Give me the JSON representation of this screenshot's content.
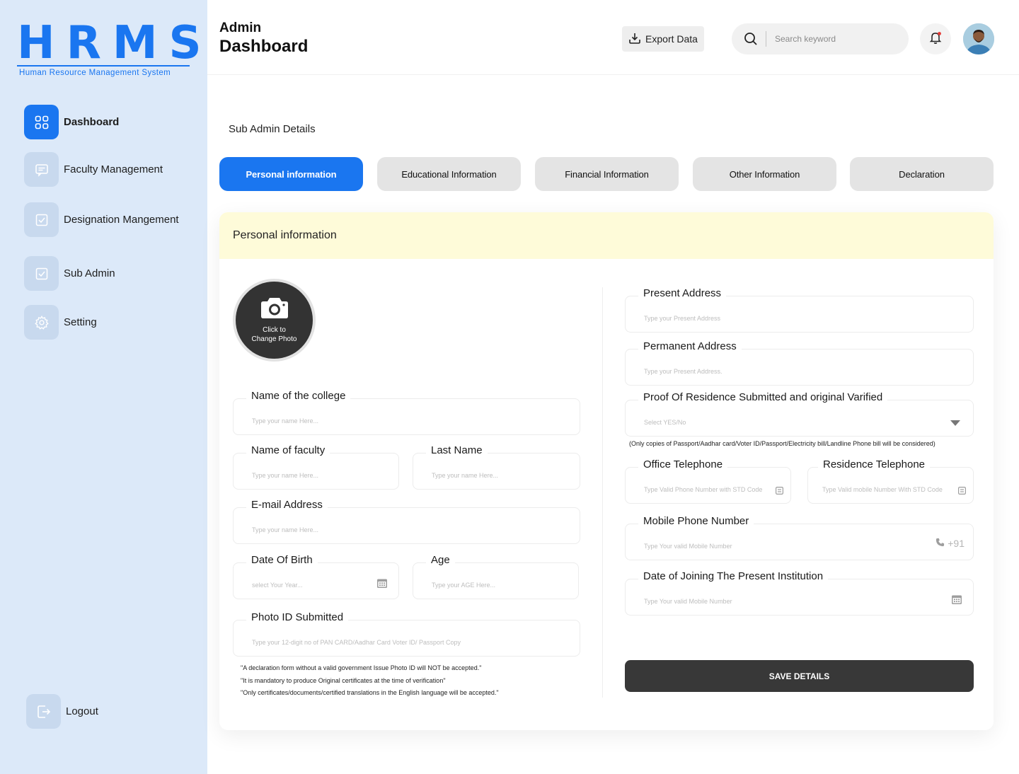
{
  "brand": {
    "logo_text": "HRMS",
    "subtitle": "Human Resource Management System",
    "color": "#1a76f0"
  },
  "sidebar": {
    "items": [
      {
        "label": "Dashboard",
        "icon": "grid-icon",
        "active": true
      },
      {
        "label": "Faculty Management",
        "icon": "message-icon"
      },
      {
        "label": "Designation Mangement",
        "icon": "checkbox-icon"
      },
      {
        "label": "Sub Admin",
        "icon": "checkbox-icon"
      },
      {
        "label": "Setting",
        "icon": "gear-icon"
      }
    ],
    "logout_label": "Logout"
  },
  "header": {
    "role": "Admin",
    "title": "Dashboard",
    "export_label": "Export Data",
    "search_placeholder": "Search keyword"
  },
  "section_title": "Sub Admin Details",
  "tabs": [
    {
      "label": "Personal information",
      "active": true
    },
    {
      "label": "Educational Information"
    },
    {
      "label": "Financial Information"
    },
    {
      "label": "Other Information"
    },
    {
      "label": "Declaration"
    }
  ],
  "card": {
    "title": "Personal information",
    "photo_label_line1": "Click to",
    "photo_label_line2": "Change Photo"
  },
  "left_fields": {
    "college": {
      "label": "Name of the college",
      "placeholder": "Type your name Here..."
    },
    "faculty": {
      "label": "Name of faculty",
      "placeholder": "Type your name Here..."
    },
    "last_name": {
      "label": "Last Name",
      "placeholder": "Type your name Here..."
    },
    "email": {
      "label": "E-mail Address",
      "placeholder": "Type your name Here..."
    },
    "dob": {
      "label": "Date Of Birth",
      "placeholder": "select Your Year..."
    },
    "age": {
      "label": "Age",
      "placeholder": "Type your AGE Here..."
    },
    "photo_id": {
      "label": "Photo ID Submitted",
      "placeholder": "Type your 12-digit no of PAN CARD/Aadhar Card Voter ID/ Passport Copy"
    }
  },
  "notes": [
    "\"A declaration form without a valid government Issue Photo ID will NOT be accepted.\"",
    "\"It is mandatory to produce Original certificates at the time of verification\"",
    "\"Only certificates/documents/certified translations in the English language will be accepted.\""
  ],
  "right_fields": {
    "present_address": {
      "label": "Present Address",
      "placeholder": "Type your Present Address"
    },
    "permanent_address": {
      "label": "Permanent  Address",
      "placeholder": "Type your Present Address."
    },
    "residence_proof": {
      "label": "Proof Of Residence Submitted and original Varified",
      "placeholder": "Select  YES/No"
    },
    "residence_note": "(Only copies of Passport/Aadhar card/Voter ID/Passport/Electricity bill/Landline Phone bill will be considered)",
    "office_phone": {
      "label": "Office Telephone",
      "placeholder": "Type Valid Phone Number with STD Code"
    },
    "residence_phone": {
      "label": "Residence Telephone",
      "placeholder": "Type Valid mobile Number With STD Code"
    },
    "mobile": {
      "label": "Mobile Phone Number",
      "placeholder": "Type Your valid Mobile Number",
      "prefix": "+91"
    },
    "joining_date": {
      "label": "Date of Joining The Present Institution",
      "placeholder": "Type Your valid Mobile Number"
    }
  },
  "save_label": "SAVE DETAILS"
}
